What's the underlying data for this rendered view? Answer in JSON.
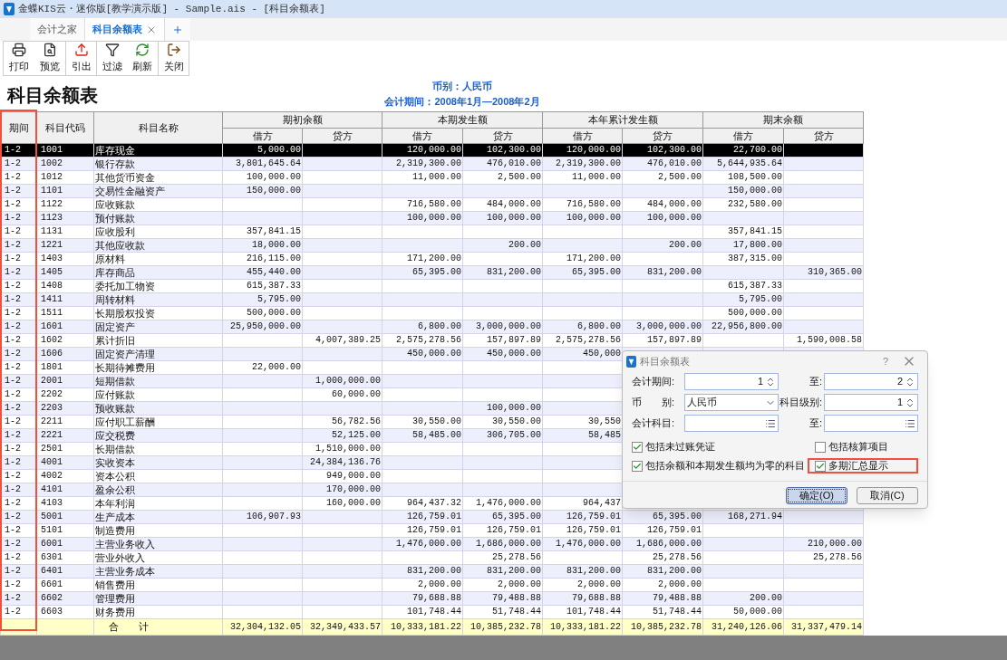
{
  "window": {
    "title": "金蝶KIS云・迷你版[教学演示版] - Sample.ais - [科目余额表]"
  },
  "tabs": [
    {
      "label": "会计之家",
      "selected": false,
      "closable": false
    },
    {
      "label": "科目余额表",
      "selected": true,
      "closable": true
    }
  ],
  "toolbar": [
    {
      "label": "打印",
      "kind": "print"
    },
    {
      "label": "预览",
      "kind": "preview"
    },
    {
      "label": "引出",
      "kind": "export"
    },
    {
      "label": "过滤",
      "kind": "filter"
    },
    {
      "label": "刷新",
      "kind": "refresh"
    },
    {
      "label": "关闭",
      "kind": "close"
    }
  ],
  "report": {
    "title": "科目余额表",
    "currency": "币别：人民币",
    "period": "会计期间：2008年1月—2008年2月"
  },
  "table": {
    "fixed_columns": [
      {
        "label": "期间",
        "highlighted": true
      },
      {
        "label": "科目代码",
        "highlighted": false
      },
      {
        "label": "科目名称",
        "highlighted": false
      }
    ],
    "groups": [
      {
        "label": "期初余额",
        "columns": [
          "借方",
          "贷方"
        ]
      },
      {
        "label": "本期发生额",
        "columns": [
          "借方",
          "贷方"
        ]
      },
      {
        "label": "本年累计发生额",
        "columns": [
          "借方",
          "贷方"
        ]
      },
      {
        "label": "期末余额",
        "columns": [
          "借方",
          "贷方"
        ]
      }
    ],
    "rows": [
      {
        "period": "1-2",
        "code": "1001",
        "name": "库存现金",
        "selected": true,
        "opening_debit": "5,000.00",
        "period_debit": "120,000.00",
        "period_credit": "102,300.00",
        "ytd_debit": "120,000.00",
        "ytd_credit": "102,300.00",
        "closing_debit": "22,700.00"
      },
      {
        "period": "1-2",
        "code": "1002",
        "name": "银行存款",
        "selected": false,
        "opening_debit": "3,801,645.64",
        "period_debit": "2,319,300.00",
        "period_credit": "476,010.00",
        "ytd_debit": "2,319,300.00",
        "ytd_credit": "476,010.00",
        "closing_debit": "5,644,935.64"
      },
      {
        "period": "1-2",
        "code": "1012",
        "name": "其他货币资金",
        "selected": false,
        "opening_debit": "100,000.00",
        "period_debit": "11,000.00",
        "period_credit": "2,500.00",
        "ytd_debit": "11,000.00",
        "ytd_credit": "2,500.00",
        "closing_debit": "108,500.00"
      },
      {
        "period": "1-2",
        "code": "1101",
        "name": "交易性金融资产",
        "selected": false,
        "opening_debit": "150,000.00",
        "closing_debit": "150,000.00"
      },
      {
        "period": "1-2",
        "code": "1122",
        "name": "应收账款",
        "selected": false,
        "period_debit": "716,580.00",
        "period_credit": "484,000.00",
        "ytd_debit": "716,580.00",
        "ytd_credit": "484,000.00",
        "closing_debit": "232,580.00"
      },
      {
        "period": "1-2",
        "code": "1123",
        "name": "预付账款",
        "selected": false,
        "period_debit": "100,000.00",
        "period_credit": "100,000.00",
        "ytd_debit": "100,000.00",
        "ytd_credit": "100,000.00"
      },
      {
        "period": "1-2",
        "code": "1131",
        "name": "应收股利",
        "selected": false,
        "opening_debit": "357,841.15",
        "closing_debit": "357,841.15"
      },
      {
        "period": "1-2",
        "code": "1221",
        "name": "其他应收款",
        "selected": false,
        "opening_debit": "18,000.00",
        "period_credit": "200.00",
        "ytd_credit": "200.00",
        "closing_debit": "17,800.00"
      },
      {
        "period": "1-2",
        "code": "1403",
        "name": "原材料",
        "selected": false,
        "opening_debit": "216,115.00",
        "period_debit": "171,200.00",
        "ytd_debit": "171,200.00",
        "closing_debit": "387,315.00"
      },
      {
        "period": "1-2",
        "code": "1405",
        "name": "库存商品",
        "selected": false,
        "opening_debit": "455,440.00",
        "period_debit": "65,395.00",
        "period_credit": "831,200.00",
        "ytd_debit": "65,395.00",
        "ytd_credit": "831,200.00",
        "closing_credit": "310,365.00"
      },
      {
        "period": "1-2",
        "code": "1408",
        "name": "委托加工物资",
        "selected": false,
        "opening_debit": "615,387.33",
        "closing_debit": "615,387.33"
      },
      {
        "period": "1-2",
        "code": "1411",
        "name": "周转材料",
        "selected": false,
        "opening_debit": "5,795.00",
        "closing_debit": "5,795.00"
      },
      {
        "period": "1-2",
        "code": "1511",
        "name": "长期股权投资",
        "selected": false,
        "opening_debit": "500,000.00",
        "closing_debit": "500,000.00"
      },
      {
        "period": "1-2",
        "code": "1601",
        "name": "固定资产",
        "selected": false,
        "opening_debit": "25,950,000.00",
        "period_debit": "6,800.00",
        "period_credit": "3,000,000.00",
        "ytd_debit": "6,800.00",
        "ytd_credit": "3,000,000.00",
        "closing_debit": "22,956,800.00"
      },
      {
        "period": "1-2",
        "code": "1602",
        "name": "累计折旧",
        "selected": false,
        "opening_credit": "4,007,389.25",
        "period_debit": "2,575,278.56",
        "period_credit": "157,897.89",
        "ytd_debit": "2,575,278.56",
        "ytd_credit": "157,897.89",
        "closing_credit": "1,590,008.58"
      },
      {
        "period": "1-2",
        "code": "1606",
        "name": "固定资产清理",
        "selected": false,
        "period_debit": "450,000.00",
        "period_credit": "450,000.00",
        "ytd_debit": "450,000"
      },
      {
        "period": "1-2",
        "code": "1801",
        "name": "长期待摊费用",
        "selected": false,
        "opening_debit": "22,000.00"
      },
      {
        "period": "1-2",
        "code": "2001",
        "name": "短期借款",
        "selected": false,
        "opening_credit": "1,000,000.00"
      },
      {
        "period": "1-2",
        "code": "2202",
        "name": "应付账款",
        "selected": false,
        "opening_credit": "60,000.00"
      },
      {
        "period": "1-2",
        "code": "2203",
        "name": "预收账款",
        "selected": false,
        "period_credit": "100,000.00"
      },
      {
        "period": "1-2",
        "code": "2211",
        "name": "应付职工薪酬",
        "selected": false,
        "opening_credit": "56,782.56",
        "period_debit": "30,550.00",
        "period_credit": "30,550.00",
        "ytd_debit": "30,550"
      },
      {
        "period": "1-2",
        "code": "2221",
        "name": "应交税费",
        "selected": false,
        "opening_credit": "52,125.00",
        "period_debit": "58,485.00",
        "period_credit": "306,705.00",
        "ytd_debit": "58,485"
      },
      {
        "period": "1-2",
        "code": "2501",
        "name": "长期借款",
        "selected": false,
        "opening_credit": "1,510,000.00"
      },
      {
        "period": "1-2",
        "code": "4001",
        "name": "实收资本",
        "selected": false,
        "opening_credit": "24,384,136.76"
      },
      {
        "period": "1-2",
        "code": "4002",
        "name": "资本公积",
        "selected": false,
        "opening_credit": "949,000.00"
      },
      {
        "period": "1-2",
        "code": "4101",
        "name": "盈余公积",
        "selected": false,
        "opening_credit": "170,000.00"
      },
      {
        "period": "1-2",
        "code": "4103",
        "name": "本年利润",
        "selected": false,
        "opening_credit": "160,000.00",
        "period_debit": "964,437.32",
        "period_credit": "1,476,000.00",
        "ytd_debit": "964,437"
      },
      {
        "period": "1-2",
        "code": "5001",
        "name": "生产成本",
        "selected": false,
        "opening_debit": "106,907.93",
        "period_debit": "126,759.01",
        "period_credit": "65,395.00",
        "ytd_debit": "126,759.01",
        "ytd_credit": "65,395.00",
        "closing_debit": "168,271.94"
      },
      {
        "period": "1-2",
        "code": "5101",
        "name": "制造费用",
        "selected": false,
        "period_debit": "126,759.01",
        "period_credit": "126,759.01",
        "ytd_debit": "126,759.01",
        "ytd_credit": "126,759.01"
      },
      {
        "period": "1-2",
        "code": "6001",
        "name": "主营业务收入",
        "selected": false,
        "period_debit": "1,476,000.00",
        "period_credit": "1,686,000.00",
        "ytd_debit": "1,476,000.00",
        "ytd_credit": "1,686,000.00",
        "closing_credit": "210,000.00"
      },
      {
        "period": "1-2",
        "code": "6301",
        "name": "营业外收入",
        "selected": false,
        "period_credit": "25,278.56",
        "ytd_credit": "25,278.56",
        "closing_credit": "25,278.56"
      },
      {
        "period": "1-2",
        "code": "6401",
        "name": "主营业务成本",
        "selected": false,
        "period_debit": "831,200.00",
        "period_credit": "831,200.00",
        "ytd_debit": "831,200.00",
        "ytd_credit": "831,200.00"
      },
      {
        "period": "1-2",
        "code": "6601",
        "name": "销售费用",
        "selected": false,
        "period_debit": "2,000.00",
        "period_credit": "2,000.00",
        "ytd_debit": "2,000.00",
        "ytd_credit": "2,000.00"
      },
      {
        "period": "1-2",
        "code": "6602",
        "name": "管理费用",
        "selected": false,
        "period_debit": "79,688.88",
        "period_credit": "79,488.88",
        "ytd_debit": "79,688.88",
        "ytd_credit": "79,488.88",
        "closing_debit": "200.00"
      },
      {
        "period": "1-2",
        "code": "6603",
        "name": "财务费用",
        "selected": false,
        "period_debit": "101,748.44",
        "period_credit": "51,748.44",
        "ytd_debit": "101,748.44",
        "ytd_credit": "51,748.44",
        "closing_debit": "50,000.00"
      }
    ],
    "total": {
      "label": "合　　计",
      "opening_debit": "32,304,132.05",
      "opening_credit": "32,349,433.57",
      "period_debit": "10,333,181.22",
      "period_credit": "10,385,232.78",
      "ytd_debit": "10,333,181.22",
      "ytd_credit": "10,385,232.78",
      "closing_debit": "31,240,126.06",
      "closing_credit": "31,337,479.14"
    }
  },
  "dialog": {
    "title": "科目余额表",
    "help": "?",
    "fields": [
      {
        "label": "会计期间:",
        "value": "1",
        "kind": "spin"
      },
      {
        "label": "至:",
        "value": "2",
        "kind": "spin"
      },
      {
        "label": "币　　别:",
        "value": "人民币",
        "kind": "select"
      },
      {
        "label": "科目级别:",
        "value": "1",
        "kind": "spin"
      },
      {
        "label": "会计科目:",
        "kind": "browse"
      },
      {
        "label": "至:",
        "kind": "browse"
      }
    ],
    "options": [
      {
        "label": "包括未过账凭证",
        "checked": true,
        "highlighted": false
      },
      {
        "label": "包括核算项目",
        "checked": false,
        "highlighted": false
      },
      {
        "label": "包括余额和本期发生额均为零的科目",
        "checked": true,
        "highlighted": false
      },
      {
        "label": "多期汇总显示",
        "checked": true,
        "highlighted": true
      }
    ],
    "buttons": [
      {
        "label": "确定(O)",
        "focused": true
      },
      {
        "label": "取消(C)",
        "focused": false
      }
    ]
  }
}
